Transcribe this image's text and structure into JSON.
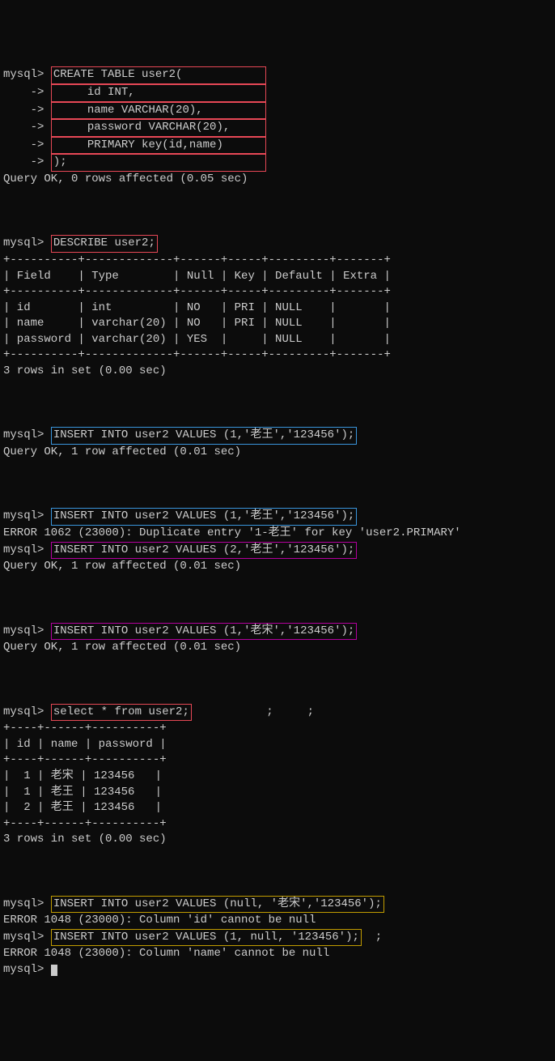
{
  "prompt": "mysql>",
  "cont": "    ->",
  "create": {
    "l1": "CREATE TABLE user2(",
    "l2": "     id INT,",
    "l3": "     name VARCHAR(20),",
    "l4": "     password VARCHAR(20),",
    "l5": "     PRIMARY key(id,name)",
    "l6": ");"
  },
  "createResult": "Query OK, 0 rows affected (0.05 sec)",
  "describe": "DESCRIBE user2;",
  "descTable": {
    "sep": "+----------+-------------+------+-----+---------+-------+",
    "hdr": "| Field    | Type        | Null | Key | Default | Extra |",
    "r1": "| id       | int         | NO   | PRI | NULL    |       |",
    "r2": "| name     | varchar(20) | NO   | PRI | NULL    |       |",
    "r3": "| password | varchar(20) | YES  |     | NULL    |       |"
  },
  "descResult": "3 rows in set (0.00 sec)",
  "insert1": "INSERT INTO user2 VALUES (1,'老王','123456');",
  "insert1Result": "Query OK, 1 row affected (0.01 sec)",
  "insert2": "INSERT INTO user2 VALUES (1,'老王','123456');",
  "insert2Error": "ERROR 1062 (23000): Duplicate entry '1-老王' for key 'user2.PRIMARY'",
  "insert3": "INSERT INTO user2 VALUES (2,'老王','123456');",
  "insert3Result": "Query OK, 1 row affected (0.01 sec)",
  "insert4": "INSERT INTO user2 VALUES (1,'老宋','123456');",
  "insert4Result": "Query OK, 1 row affected (0.01 sec)",
  "select": "select * from user2;",
  "selectExtra": "           ;     ;",
  "selTable": {
    "sep": "+----+------+----------+",
    "hdr": "| id | name | password |",
    "r1": "|  1 | 老宋 | 123456   |",
    "r2": "|  1 | 老王 | 123456   |",
    "r3": "|  2 | 老王 | 123456   |"
  },
  "selResult": "3 rows in set (0.00 sec)",
  "insert5": "INSERT INTO user2 VALUES (null, '老宋','123456');",
  "insert5Error": "ERROR 1048 (23000): Column 'id' cannot be null",
  "insert6": "INSERT INTO user2 VALUES (1, null, '123456');",
  "insert6Extra": "  ;",
  "insert6Error": "ERROR 1048 (23000): Column 'name' cannot be null"
}
